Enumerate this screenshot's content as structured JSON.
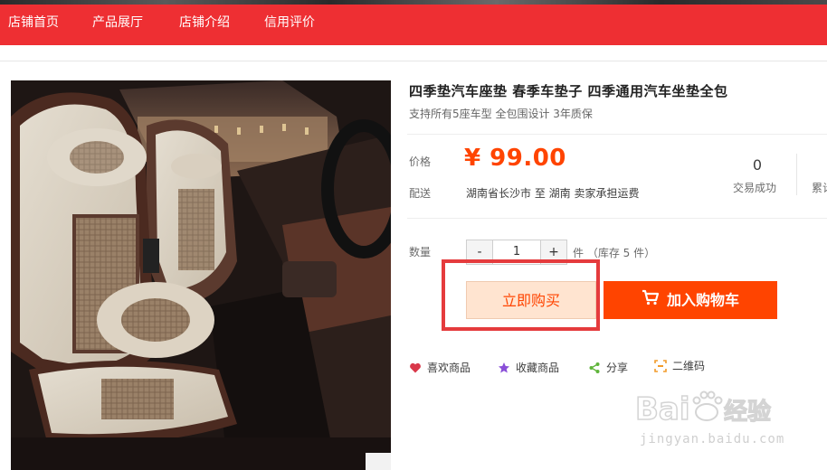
{
  "nav": {
    "items": [
      "店铺首页",
      "产品展厅",
      "店铺介绍",
      "信用评价"
    ]
  },
  "product": {
    "title": "四季垫汽车座垫 春季车垫子 四季通用汽车坐垫全包",
    "subtitle": "支持所有5座车型 全包围设计 3年质保",
    "price_label": "价格",
    "price": "¥ 99.00",
    "shipping_label": "配送",
    "shipping": "湖南省长沙市 至 湖南 卖家承担运费",
    "deals_count": "0",
    "deals_label": "交易成功",
    "reviews_label": "累计",
    "quantity_label": "数量",
    "quantity_minus": "-",
    "quantity_value": "1",
    "quantity_plus": "+",
    "stock_text": "件 （库存 5 件）",
    "buy_now": "立即购买",
    "add_to_cart": "加入购物车"
  },
  "actions": [
    {
      "icon": "heart-icon",
      "label": "喜欢商品",
      "color": "#d9384a"
    },
    {
      "icon": "star-icon",
      "label": "收藏商品",
      "color": "#8a4fd8"
    },
    {
      "icon": "share-icon",
      "label": "分享",
      "color": "#5fb43a"
    },
    {
      "icon": "qrcode-icon",
      "label": "二维码",
      "color": "#f29b2a"
    }
  ],
  "watermark": {
    "logo": "Baidu经验",
    "url": "jingyan.baidu.com"
  },
  "colors": {
    "nav_bg": "#ee2f33",
    "price": "#ff4400",
    "cart_btn": "#ff4400",
    "buy_btn_bg": "#ffe4d0",
    "highlight": "#e53b3d"
  }
}
